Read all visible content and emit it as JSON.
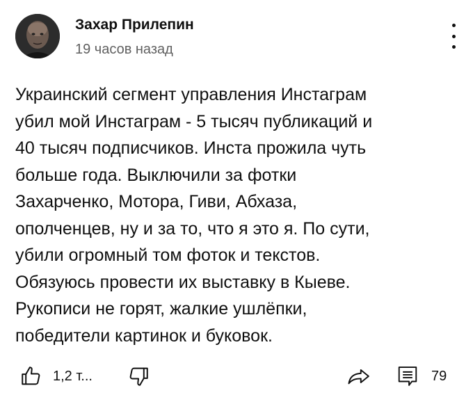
{
  "post": {
    "author": "Захар Прилепин",
    "timestamp": "19 часов назад",
    "text_lines": [
      "Украинский сегмент управления Инстаграм",
      "убил мой Инстаграм - 5 тысяч публикаций и",
      "40 тысяч подписчиков. Инста прожила чуть",
      "больше года. Выключили за фотки",
      "Захарченко, Мотора, Гиви, Абхаза,",
      "ополченцев, ну и за то, что я это я. По сути,",
      "убили огромный том фоток и текстов.",
      "Обязуюсь провести их выставку в Кыеве.",
      "Рукописи не горят, жалкие ушлёпки,",
      "победители картинок и буковок."
    ]
  },
  "actions": {
    "like_count": "1,2 т...",
    "comment_count": "79",
    "icons": {
      "like": "thumbs-up-icon",
      "dislike": "thumbs-down-icon",
      "share": "share-arrow-icon",
      "comment": "comment-icon",
      "menu": "more-vert-icon"
    }
  },
  "colors": {
    "text": "#0f0f0f",
    "secondary_text": "#606060",
    "background": "#ffffff"
  }
}
